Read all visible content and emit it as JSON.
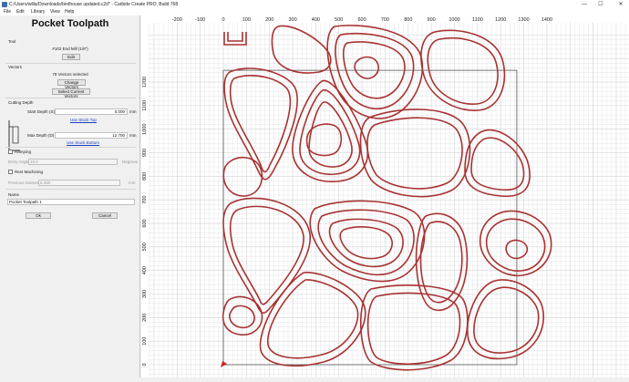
{
  "window": {
    "title": "C:/Users/willa/Downloads/birdhouse updated.c2d* - Carbide Create PRO, Build 768",
    "minimize": "—",
    "maximize": "☐",
    "close": "✕"
  },
  "menu": [
    "File",
    "Edit",
    "Library",
    "View",
    "Help"
  ],
  "panel": {
    "title": "Pocket Toolpath",
    "tool": {
      "heading": "Tool",
      "name": "#102 End Mill (1/8\")",
      "edit_label": "Edit"
    },
    "vectors": {
      "heading": "Vectors",
      "status": "78 Vectors selected",
      "change_label": "Change Vectors",
      "select_label": "Select Current Vectors"
    },
    "cutting_depth": {
      "heading": "Cutting Depth",
      "start_label": "Start Depth (S)",
      "start_value": "0.000",
      "start_unit": "mm",
      "use_stock_top": "Use Stock Top",
      "max_label": "Max Depth (D)",
      "max_value": "12.700",
      "max_unit": "mm",
      "use_stock_bottom": "Use Stock Bottom"
    },
    "ramping": {
      "label": "Ramping",
      "entry_angle_label": "Entry Angle",
      "entry_angle_value": "10.0",
      "entry_angle_unit": "Degrees"
    },
    "rest_machining": {
      "label": "Rest Machining",
      "prev_diameter_label": "Previous Diameter",
      "prev_diameter_value": "6.350",
      "prev_diameter_unit": "mm"
    },
    "name": {
      "heading": "Name",
      "value": "Pocket Toolpath 1"
    },
    "ok_label": "Ok",
    "cancel_label": "Cancel"
  },
  "canvas": {
    "x_ticks": [
      "-200",
      "-100",
      "0",
      "100",
      "200",
      "300",
      "400",
      "500",
      "600",
      "700",
      "800",
      "900",
      "1000",
      "1100",
      "1200",
      "1300",
      "1400"
    ],
    "y_ticks": [
      "1200",
      "1100",
      "1000",
      "900",
      "800",
      "700",
      "600",
      "500",
      "400",
      "300",
      "200",
      "100",
      "0"
    ],
    "toolpath_color": "#a83232",
    "grid_color": "#d3d3d3",
    "background": "#ffffff"
  }
}
